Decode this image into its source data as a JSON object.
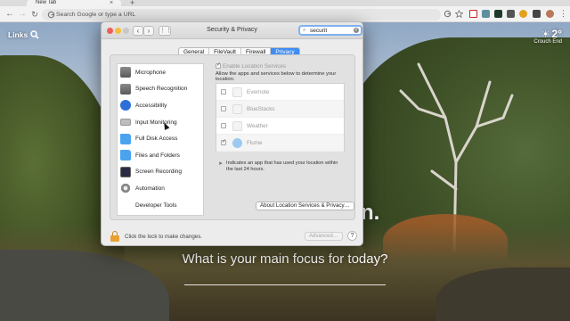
{
  "browser": {
    "tab_title": "New Tab",
    "tab_close": "×",
    "new_tab": "+",
    "omnibox_placeholder": "Search Google or type a URL"
  },
  "overlay": {
    "links_label": "Links",
    "weather_temp": "2°",
    "weather_location": "Crouch End",
    "clock_fragment": "n.",
    "focus_question": "What is your main focus for today?"
  },
  "window": {
    "title": "Security & Privacy",
    "search_value": "securit",
    "tabs": [
      {
        "label": "General"
      },
      {
        "label": "FileVault"
      },
      {
        "label": "Firewall"
      },
      {
        "label": "Privacy",
        "active": true
      }
    ],
    "privacy_list": [
      {
        "label": "Microphone",
        "icon": "microphone-icon"
      },
      {
        "label": "Speech Recognition",
        "icon": "speech-recognition-icon"
      },
      {
        "label": "Accessibility",
        "icon": "accessibility-icon"
      },
      {
        "label": "Input Monitoring",
        "icon": "keyboard-icon"
      },
      {
        "label": "Full Disk Access",
        "icon": "folder-icon"
      },
      {
        "label": "Files and Folders",
        "icon": "folder-icon"
      },
      {
        "label": "Screen Recording",
        "icon": "screen-recording-icon"
      },
      {
        "label": "Automation",
        "icon": "gear-icon"
      },
      {
        "label": "Developer Tools",
        "icon": ""
      }
    ],
    "location": {
      "enable_label": "Enable Location Services",
      "description": "Allow the apps and services below to determine your location.",
      "apps": [
        {
          "name": "Evernote",
          "checked": false
        },
        {
          "name": "BlueStacks",
          "checked": false
        },
        {
          "name": "Weather",
          "checked": false
        },
        {
          "name": "Flume",
          "checked": true
        }
      ],
      "note": "Indicates an app that has used your location within the last 24 hours.",
      "about_button": "About Location Services & Privacy…"
    },
    "footer": {
      "lock_text": "Click the lock to make changes.",
      "advanced_button": "Advanced…",
      "help_button": "?"
    }
  }
}
